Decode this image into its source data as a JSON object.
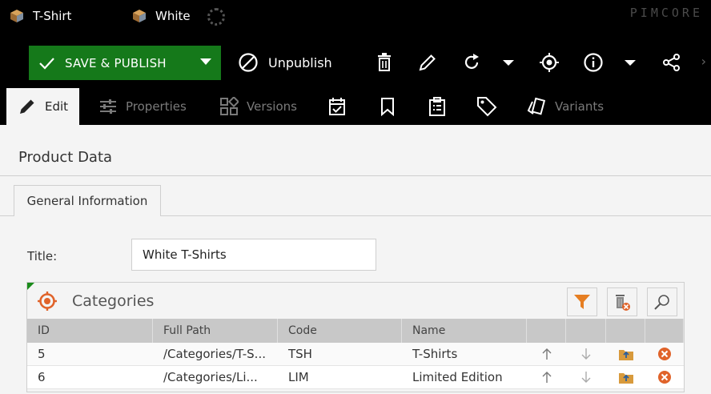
{
  "object_tabs": [
    {
      "label": "T-Shirt"
    },
    {
      "label": "White"
    }
  ],
  "brand": {
    "logo_text": "PIMCORE"
  },
  "toolbar": {
    "save_publish_label": "SAVE & PUBLISH",
    "unpublish_label": "Unpublish",
    "accent_color": "#15791a",
    "icons": [
      "delete-icon",
      "rename-icon",
      "reload-icon",
      "locate-icon",
      "info-icon",
      "share-icon"
    ]
  },
  "editor_tabs": [
    {
      "label": "Edit",
      "active": true
    },
    {
      "label": "Properties"
    },
    {
      "label": "Versions"
    },
    {
      "label": ""
    },
    {
      "label": ""
    },
    {
      "label": ""
    },
    {
      "label": ""
    },
    {
      "label": "Variants"
    }
  ],
  "panel": {
    "title": "Product Data",
    "subtab": "General Information"
  },
  "fields": {
    "title_label": "Title:",
    "title_value": "White T-Shirts"
  },
  "categories": {
    "title": "Categories",
    "columns": [
      "ID",
      "Full Path",
      "Code",
      "Name",
      "",
      "",
      "",
      ""
    ],
    "rows": [
      {
        "id": "5",
        "path": "/Categories/T-S...",
        "code": "TSH",
        "name": "T-Shirts"
      },
      {
        "id": "6",
        "path": "/Categories/Li...",
        "code": "LIM",
        "name": "Limited Edition"
      }
    ]
  }
}
